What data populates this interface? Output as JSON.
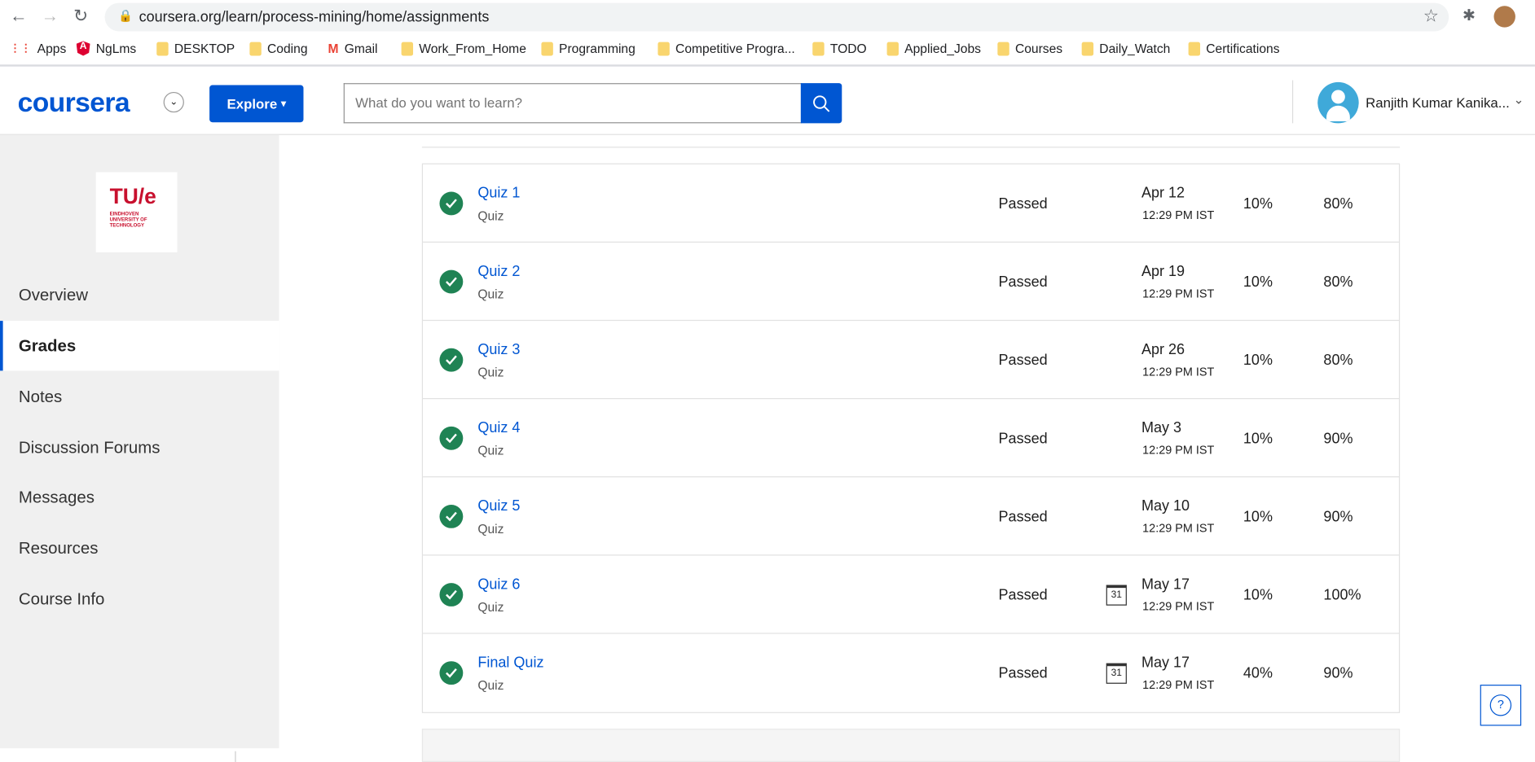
{
  "browser": {
    "url": "coursera.org/learn/process-mining/home/assignments",
    "bookmarks": [
      "Apps",
      "NgLms",
      "DESKTOP",
      "Coding",
      "Gmail",
      "Work_From_Home",
      "Programming",
      "Competitive Progra...",
      "TODO",
      "Applied_Jobs",
      "Courses",
      "Daily_Watch",
      "Certifications"
    ]
  },
  "header": {
    "logo": "coursera",
    "explore": "Explore",
    "search_placeholder": "What do you want to learn?",
    "user": "Ranjith Kumar Kanika..."
  },
  "sidebar": {
    "logo_main": "TU/e",
    "logo_sub": "EINDHOVEN UNIVERSITY OF TECHNOLOGY",
    "items": [
      {
        "label": "Overview"
      },
      {
        "label": "Grades",
        "active": true
      },
      {
        "label": "Notes"
      },
      {
        "label": "Discussion Forums"
      },
      {
        "label": "Messages"
      },
      {
        "label": "Resources"
      },
      {
        "label": "Course Info"
      }
    ]
  },
  "assignments": [
    {
      "title": "Quiz 1",
      "type": "Quiz",
      "status": "Passed",
      "date": "Apr 12",
      "time": "12:29 PM IST",
      "weight": "10%",
      "grade": "80%",
      "calendar": false
    },
    {
      "title": "Quiz 2",
      "type": "Quiz",
      "status": "Passed",
      "date": "Apr 19",
      "time": "12:29 PM IST",
      "weight": "10%",
      "grade": "80%",
      "calendar": false
    },
    {
      "title": "Quiz 3",
      "type": "Quiz",
      "status": "Passed",
      "date": "Apr 26",
      "time": "12:29 PM IST",
      "weight": "10%",
      "grade": "80%",
      "calendar": false
    },
    {
      "title": "Quiz 4",
      "type": "Quiz",
      "status": "Passed",
      "date": "May 3",
      "time": "12:29 PM IST",
      "weight": "10%",
      "grade": "90%",
      "calendar": false
    },
    {
      "title": "Quiz 5",
      "type": "Quiz",
      "status": "Passed",
      "date": "May 10",
      "time": "12:29 PM IST",
      "weight": "10%",
      "grade": "90%",
      "calendar": false
    },
    {
      "title": "Quiz 6",
      "type": "Quiz",
      "status": "Passed",
      "date": "May 17",
      "time": "12:29 PM IST",
      "weight": "10%",
      "grade": "100%",
      "calendar": true
    },
    {
      "title": "Final Quiz",
      "type": "Quiz",
      "status": "Passed",
      "date": "May 17",
      "time": "12:29 PM IST",
      "weight": "40%",
      "grade": "90%",
      "calendar": true
    }
  ],
  "calendar_day": "31",
  "help": "?",
  "colors": {
    "brand": "#0056d2",
    "passed": "#1f8354",
    "tue": "#c8102e"
  }
}
